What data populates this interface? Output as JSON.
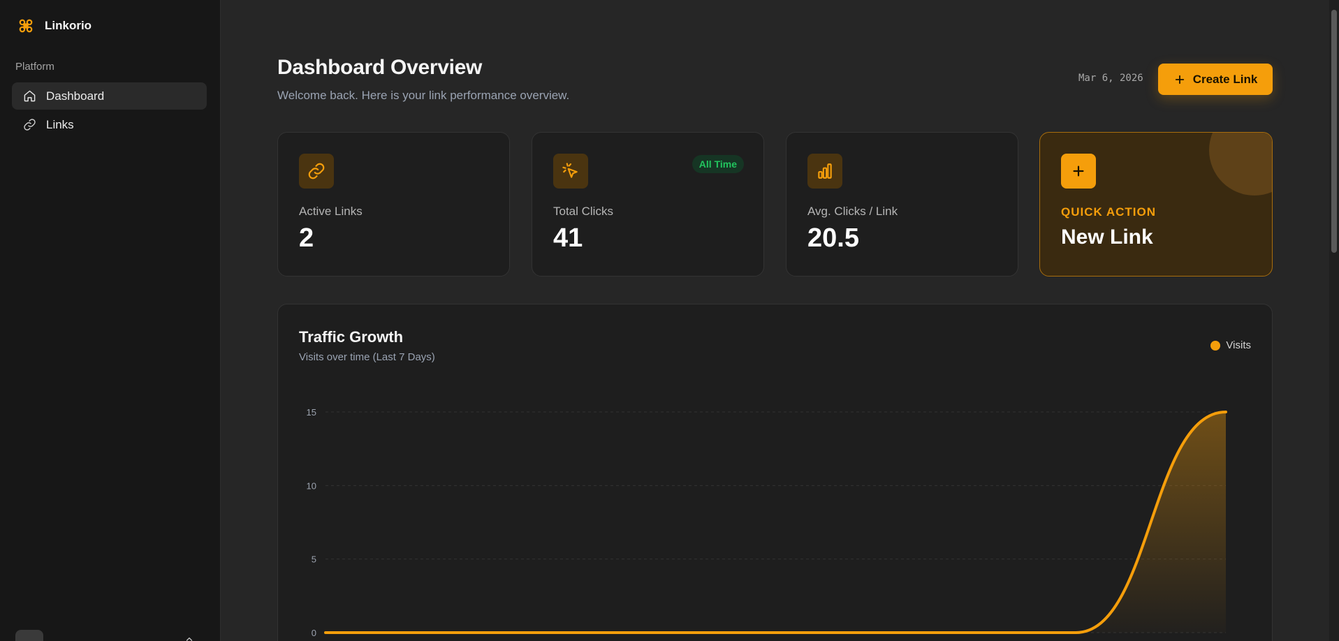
{
  "sidebar": {
    "brand": "Linkorio",
    "section": "Platform",
    "items": [
      {
        "label": "Dashboard",
        "icon": "home-icon",
        "active": true
      },
      {
        "label": "Links",
        "icon": "link-icon",
        "active": false
      }
    ]
  },
  "header": {
    "title": "Dashboard Overview",
    "subtitle": "Welcome back. Here is your link performance overview.",
    "date": "Mar 6, 2026",
    "create_label": "Create Link"
  },
  "stats": [
    {
      "label": "Active Links",
      "value": "2",
      "icon": "link-icon"
    },
    {
      "label": "Total Clicks",
      "value": "41",
      "icon": "pointer-click-icon",
      "badge": "All Time"
    },
    {
      "label": "Avg. Clicks / Link",
      "value": "20.5",
      "icon": "bar-chart-icon"
    }
  ],
  "quick_action": {
    "label": "QUICK ACTION",
    "title": "New Link",
    "icon": "plus-icon"
  },
  "colors": {
    "accent": "#f59e0b",
    "badge_green": "#22c55e"
  },
  "chart_data": {
    "type": "area",
    "title": "Traffic Growth",
    "subtitle": "Visits over time (Last 7 Days)",
    "series": [
      {
        "name": "Visits",
        "values": [
          0,
          0,
          0,
          0,
          0,
          0,
          15
        ]
      }
    ],
    "ylim": [
      0,
      15
    ],
    "yticks": [
      0,
      5,
      10,
      15
    ],
    "grid": true,
    "legend": "top-right"
  }
}
